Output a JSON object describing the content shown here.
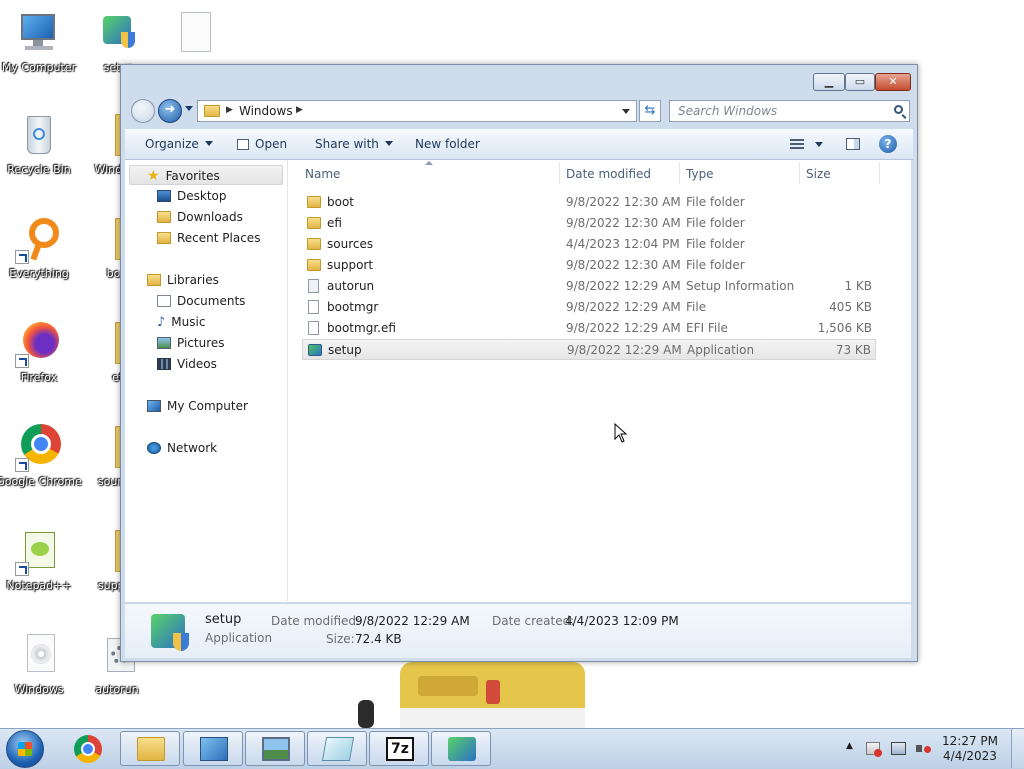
{
  "desktop": {
    "icons": [
      {
        "label": "My Computer"
      },
      {
        "label": "setup"
      },
      {
        "label": ""
      },
      {
        "label": "Recycle Bin"
      },
      {
        "label": "Windows"
      },
      {
        "label": "Everything"
      },
      {
        "label": "boot"
      },
      {
        "label": "Firefox"
      },
      {
        "label": "efi"
      },
      {
        "label": "Google Chrome"
      },
      {
        "label": "sources"
      },
      {
        "label": "Notepad++"
      },
      {
        "label": "support"
      },
      {
        "label": "Windows"
      },
      {
        "label": "autorun"
      }
    ]
  },
  "explorer": {
    "address": {
      "crumb": "Windows",
      "sep": "▶"
    },
    "search": {
      "placeholder": "Search Windows"
    },
    "caption": {
      "minimize": "▁",
      "maximize": "▭",
      "close": "✕"
    },
    "toolbar": {
      "organize": "Organize",
      "open": "Open",
      "share_with": "Share with",
      "new_folder": "New folder",
      "help": "?"
    },
    "nav": {
      "favorites": "Favorites",
      "desktop": "Desktop",
      "downloads": "Downloads",
      "recent_places": "Recent Places",
      "libraries": "Libraries",
      "documents": "Documents",
      "music": "Music",
      "pictures": "Pictures",
      "videos": "Videos",
      "my_computer": "My Computer",
      "network": "Network"
    },
    "columns": {
      "name": "Name",
      "date": "Date modified",
      "type": "Type",
      "size": "Size"
    },
    "files": [
      {
        "name": "boot",
        "date": "9/8/2022 12:30 AM",
        "type": "File folder",
        "size": "",
        "icon": "folder-icon"
      },
      {
        "name": "efi",
        "date": "9/8/2022 12:30 AM",
        "type": "File folder",
        "size": "",
        "icon": "folder-icon"
      },
      {
        "name": "sources",
        "date": "4/4/2023 12:04 PM",
        "type": "File folder",
        "size": "",
        "icon": "folder-icon"
      },
      {
        "name": "support",
        "date": "9/8/2022 12:30 AM",
        "type": "File folder",
        "size": "",
        "icon": "folder-icon"
      },
      {
        "name": "autorun",
        "date": "9/8/2022 12:29 AM",
        "type": "Setup Information",
        "size": "1 KB",
        "icon": "setup-info-icon"
      },
      {
        "name": "bootmgr",
        "date": "9/8/2022 12:29 AM",
        "type": "File",
        "size": "405 KB",
        "icon": "file-icon"
      },
      {
        "name": "bootmgr.efi",
        "date": "9/8/2022 12:29 AM",
        "type": "EFI File",
        "size": "1,506 KB",
        "icon": "file-icon"
      },
      {
        "name": "setup",
        "date": "9/8/2022 12:29 AM",
        "type": "Application",
        "size": "73 KB",
        "icon": "setup-app-icon",
        "selected": true
      }
    ],
    "details": {
      "name": "setup",
      "kind": "Application",
      "modified_label": "Date modified:",
      "modified_value": "9/8/2022 12:29 AM",
      "size_label": "Size:",
      "size_value": "72.4 KB",
      "created_label": "Date created:",
      "created_value": "4/4/2023 12:09 PM"
    }
  },
  "taskbar": {
    "pinned": [
      "chrome-icon",
      "file-explorer-icon",
      "control-panel-icon",
      "image-viewer-icon",
      "notepad-icon",
      "7zip-icon",
      "setup-icon"
    ],
    "seven_zip_label": "7z",
    "tray_arrow": "▲",
    "time": "12:27 PM",
    "date": "4/4/2023"
  },
  "colors": {
    "accent": "#2b70c4",
    "window_frame": "#cfdcec",
    "close_button": "#c44b2e"
  }
}
